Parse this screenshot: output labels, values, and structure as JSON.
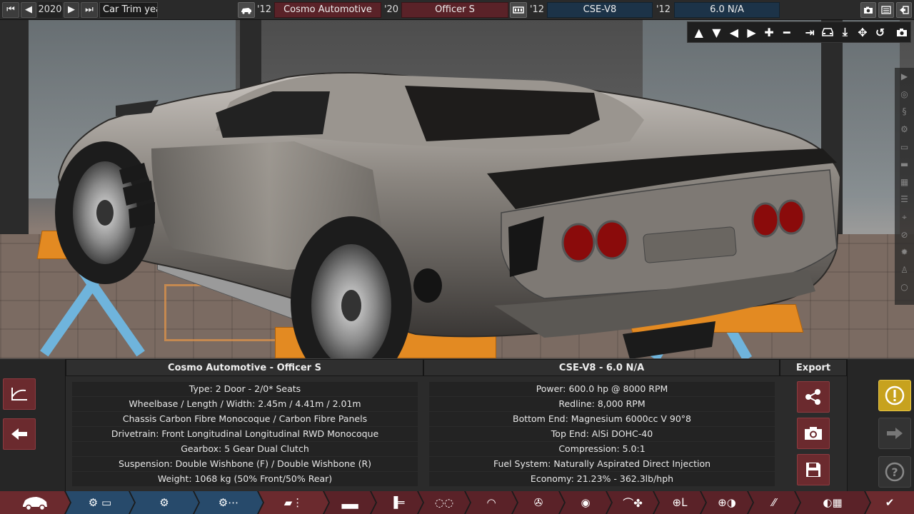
{
  "topbar": {
    "year": "2020",
    "trim_label": "Car Trim year",
    "model_year": "'12",
    "company": "Cosmo Automotive",
    "trim_year": "'20",
    "trim": "Officer S",
    "engine_year": "'12",
    "engine_family": "CSE-V8",
    "variant_year": "'12",
    "variant": "6.0 N/A"
  },
  "car_panel": {
    "title": "Cosmo Automotive - Officer S",
    "rows": [
      "Type: 2 Door - 2/0* Seats",
      "Wheelbase / Length / Width: 2.45m / 4.41m / 2.01m",
      "Chassis Carbon Fibre Monocoque / Carbon Fibre Panels",
      "Drivetrain: Front Longitudinal Longitudinal RWD Monocoque",
      "Gearbox: 5 Gear Dual Clutch",
      "Suspension: Double Wishbone (F) / Double Wishbone (R)",
      "Weight: 1068 kg (50% Front/50% Rear)"
    ]
  },
  "engine_panel": {
    "title": "CSE-V8 - 6.0 N/A",
    "rows": [
      "Power: 600.0 hp @ 8000 RPM",
      "Redline:  8,000 RPM",
      "Bottom End: Magnesium 6000cc V 90°8",
      "Top End: AlSi DOHC-40",
      "Compression: 5.0:1",
      "Fuel System: Naturally Aspirated Direct Injection",
      "Economy: 21.23% - 362.3lb/hph"
    ]
  },
  "export_panel": {
    "title": "Export"
  },
  "colors": {
    "accent_red": "#6b2a2e",
    "accent_blue": "#1c3348",
    "warning": "#c7a21e",
    "lift_orange": "#e38a22"
  },
  "icons": {
    "camera_tools": [
      "arrow-up-icon",
      "arrow-down-icon",
      "arrow-left-icon",
      "arrow-right-icon",
      "zoom-in-icon",
      "zoom-out-icon",
      "align-right-icon",
      "car-front-icon",
      "lower-icon",
      "rotate-axis-icon",
      "reset-view-icon",
      "screenshot-icon"
    ],
    "side_tools": [
      "collapse-icon",
      "wheel-icon",
      "spring-icon",
      "transmission-icon",
      "body-icon",
      "car-side-icon",
      "grille-icon",
      "exhaust-icon",
      "lift-icon",
      "no-smoke-icon",
      "gear-icon",
      "driver-icon",
      "circle-icon"
    ],
    "tabs": [
      "car-body-icon",
      "model-folder-icon",
      "engine-family-icon",
      "engine-variant-icon",
      "trim-icon",
      "chassis-icon",
      "suspension-icon",
      "drivetrain-icon",
      "gearbox-icon",
      "wheel-icon",
      "brake-icon",
      "aero-icon",
      "interior-icon",
      "steering-icon",
      "tyre-icon",
      "fuel-icon",
      "test-icon",
      "finish-check-icon"
    ]
  }
}
